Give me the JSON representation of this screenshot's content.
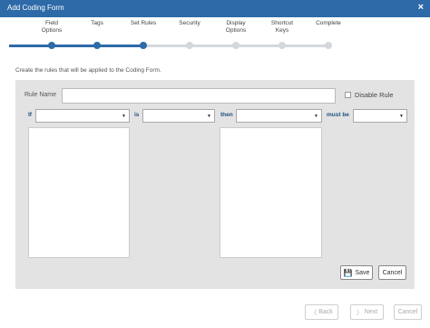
{
  "window": {
    "title": "Add Coding Form",
    "close_icon": "×"
  },
  "wizard": {
    "steps": [
      {
        "label": "Field\nOptions",
        "state": "done"
      },
      {
        "label": "Tags",
        "state": "done"
      },
      {
        "label": "Set Rules",
        "state": "current"
      },
      {
        "label": "Security",
        "state": "todo"
      },
      {
        "label": "Display\nOptions",
        "state": "todo"
      },
      {
        "label": "Shortcut\nKeys",
        "state": "todo"
      },
      {
        "label": "Complete",
        "state": "todo"
      }
    ],
    "colors": {
      "done": "#2e6aa8",
      "todo": "#d4d8dc"
    }
  },
  "instructions": "Create the rules that will be applied to the Coding Form.",
  "rule": {
    "name_label": "Rule Name",
    "name_value": "",
    "disable_label": "Disable Rule",
    "disable_checked": false,
    "if_label": "If",
    "is_label": "is",
    "then_label": "then",
    "must_be_label": "must be",
    "if_value": "",
    "is_value": "",
    "then_value": "",
    "must_be_value": ""
  },
  "actions": {
    "save_label": "Save",
    "cancel_label": "Cancel"
  },
  "footer": {
    "back_label": "Back",
    "next_label": "Next",
    "cancel_label": "Cancel"
  },
  "icons": {
    "save": "floppy-disk-icon",
    "back": "chevron-left-icon",
    "next": "chevron-right-icon",
    "caret": "caret-down-icon"
  }
}
